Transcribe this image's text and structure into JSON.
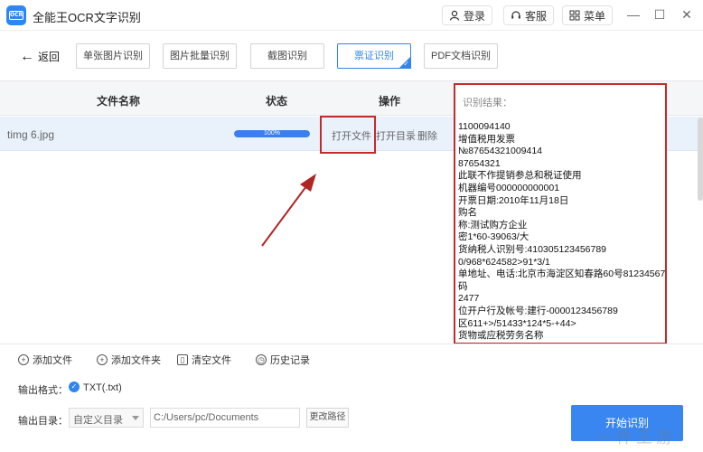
{
  "app": {
    "title": "全能王OCR文字识别",
    "logo_text": "OCR",
    "login_label": "登录",
    "support_label": "客服",
    "menu_label": "菜单"
  },
  "toolbar": {
    "back_label": "返回",
    "tabs": [
      {
        "label": "单张图片识别",
        "active": false
      },
      {
        "label": "图片批量识别",
        "active": false
      },
      {
        "label": "截图识别",
        "active": false
      },
      {
        "label": "票证识别",
        "active": true
      },
      {
        "label": "PDF文档识别",
        "active": false
      }
    ]
  },
  "table": {
    "headers": {
      "filename": "文件名称",
      "status": "状态",
      "actions": "操作"
    },
    "rows": [
      {
        "filename": "timg 6.jpg",
        "progress": 100,
        "progress_text": "100%",
        "open_file": "打开文件",
        "open_dir": "打开目录",
        "delete": "删除"
      }
    ]
  },
  "result": {
    "label": "识别结果：",
    "lines": [
      "1100094140",
      "增值税用发票",
      "№87654321009414",
      "87654321",
      "此联不作提销参总和税证使用",
      "机器编号000000000001",
      "开票日期:2010年11月18日",
      "购名",
      "称:测试购方企业",
      "密1*60-39063/大",
      "货纳税人识别号:410305123456789",
      "0/968*624582>91*3/1",
      "单地址、电话:北京市海淀区知春路60号81234567",
      "码",
      "2477",
      "位开户行及帐号:建行-0000123456789",
      "区611+>/51433*124*5-+44>",
      "货物或应税劳务名称"
    ]
  },
  "bottom": {
    "add_file": "添加文件",
    "add_folder": "添加文件夹",
    "clear_files": "清空文件",
    "history": "历史记录",
    "output_format_label": "输出格式：",
    "output_format_value": "TXT(.txt)",
    "output_dir_label": "输出目录：",
    "dir_select_value": "自定义目录",
    "path_value": "C:/Users/pc/Documents",
    "change_path": "更改路径",
    "start": "开始识别"
  },
  "watermark": "一件王游",
  "colors": {
    "accent": "#2f86f0",
    "highlight": "#c42a2a"
  }
}
